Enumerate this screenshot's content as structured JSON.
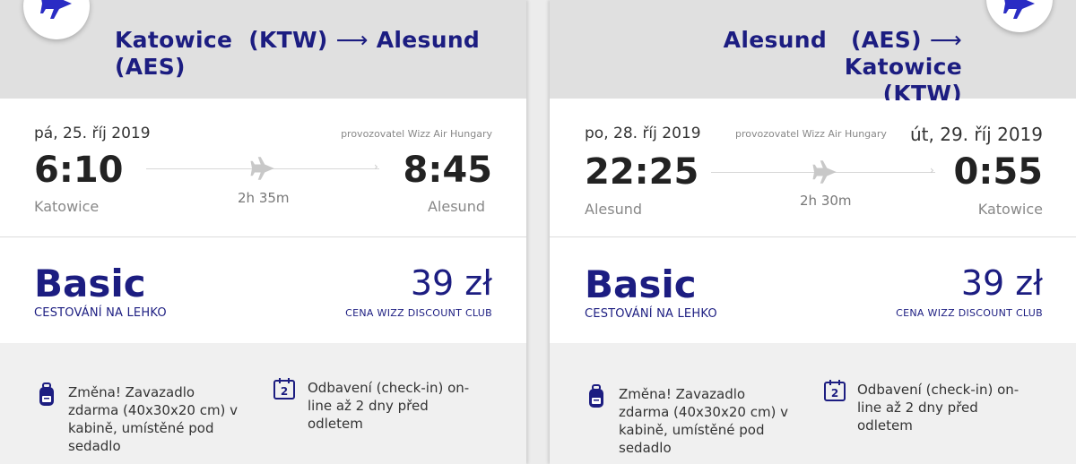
{
  "colors": {
    "brand": "#1c1d81",
    "header_bg": "#e0e0e0",
    "features_bg": "#f0f0f0"
  },
  "cards": [
    {
      "route": {
        "from": "Katowice",
        "from_code": "(KTW)",
        "to": "Alesund",
        "to_code": "(AES)",
        "arrow": "⟶"
      },
      "icon": "plane-icon",
      "date_dep": "pá, 25. říj 2019",
      "operator": "provozovatel Wizz Air Hungary",
      "dep_time": "6:10",
      "arr_time": "8:45",
      "dep_city": "Katowice",
      "arr_city": "Alesund",
      "duration": "2h 35m",
      "fare_name": "Basic",
      "fare_sub": "CESTOVÁNÍ NA LEHKO",
      "price": "39 zł",
      "price_sub": "CENA WIZZ DISCOUNT CLUB",
      "feature_bag": "Změna! Zavazadlo zdarma (40x30x20 cm) v kabině, umístěné pod sedadlo",
      "feature_checkin": "Odbavení (check-in) on-line až 2 dny před odletem",
      "checkin_badge": "2"
    },
    {
      "route": {
        "from": "Alesund",
        "from_code": "(AES)",
        "to": "Katowice",
        "to_code": "(KTW)",
        "arrow": "⟶"
      },
      "icon": "plane-icon",
      "date_dep": "po, 28. říj 2019",
      "date_arr": "út, 29. říj 2019",
      "operator": "provozovatel Wizz Air Hungary",
      "dep_time": "22:25",
      "arr_time": "0:55",
      "dep_city": "Alesund",
      "arr_city": "Katowice",
      "duration": "2h 30m",
      "fare_name": "Basic",
      "fare_sub": "CESTOVÁNÍ NA LEHKO",
      "price": "39 zł",
      "price_sub": "CENA WIZZ DISCOUNT CLUB",
      "feature_bag": "Změna! Zavazadlo zdarma (40x30x20 cm) v kabině, umístěné pod sedadlo",
      "feature_checkin": "Odbavení (check-in) on-line až 2 dny před odletem",
      "checkin_badge": "2"
    }
  ]
}
